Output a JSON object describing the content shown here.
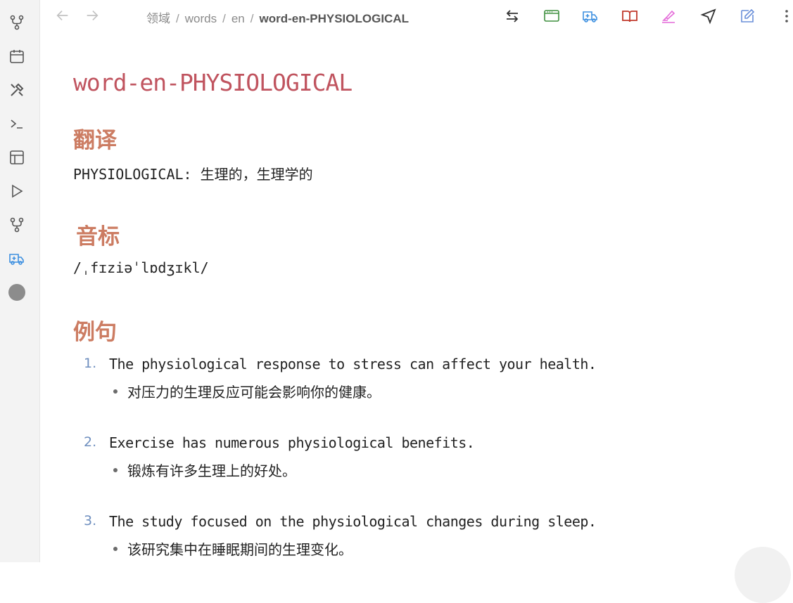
{
  "nav": {
    "breadcrumb": [
      "领域",
      "words",
      "en"
    ],
    "current": "word-en-PHYSIOLOGICAL",
    "separator": "/"
  },
  "ribbon": {
    "icons": [
      "graph-icon",
      "calendar-icon",
      "tools-icon",
      "terminal-icon",
      "layout-icon",
      "play-icon",
      "graph-alt-icon",
      "ambulance-icon",
      "avatar-circle"
    ]
  },
  "toolbar": {
    "icons": [
      "swap-icon",
      "window-icon",
      "ambulance-icon",
      "book-open-icon",
      "highlighter-icon",
      "send-icon",
      "edit-icon",
      "more-icon"
    ],
    "colors": {
      "window": "#3f8f3f",
      "ambulance": "#3c8fe0",
      "book": "#c0392b",
      "highlighter": "#e46ad9",
      "edit": "#6a8fd9"
    }
  },
  "note": {
    "title": "word-en-PHYSIOLOGICAL",
    "sections": {
      "translation": {
        "heading": "翻译",
        "text": "PHYSIOLOGICAL: 生理的，生理学的"
      },
      "phonetic": {
        "heading": "音标",
        "text": "/ˌfɪziəˈlɒdʒɪkl/"
      },
      "examples": {
        "heading": "例句",
        "items": [
          {
            "num": "1.",
            "en": "The physiological response to stress can affect your health.",
            "zh": "对压力的生理反应可能会影响你的健康。"
          },
          {
            "num": "2.",
            "en": "Exercise has numerous physiological benefits.",
            "zh": "锻炼有许多生理上的好处。"
          },
          {
            "num": "3.",
            "en": "The study focused on the physiological changes during sleep.",
            "zh": "该研究集中在睡眠期间的生理变化。"
          }
        ]
      }
    }
  },
  "colors": {
    "title": "#c0545f",
    "heading": "#cc7c62",
    "list_number": "#6f8fbf"
  }
}
